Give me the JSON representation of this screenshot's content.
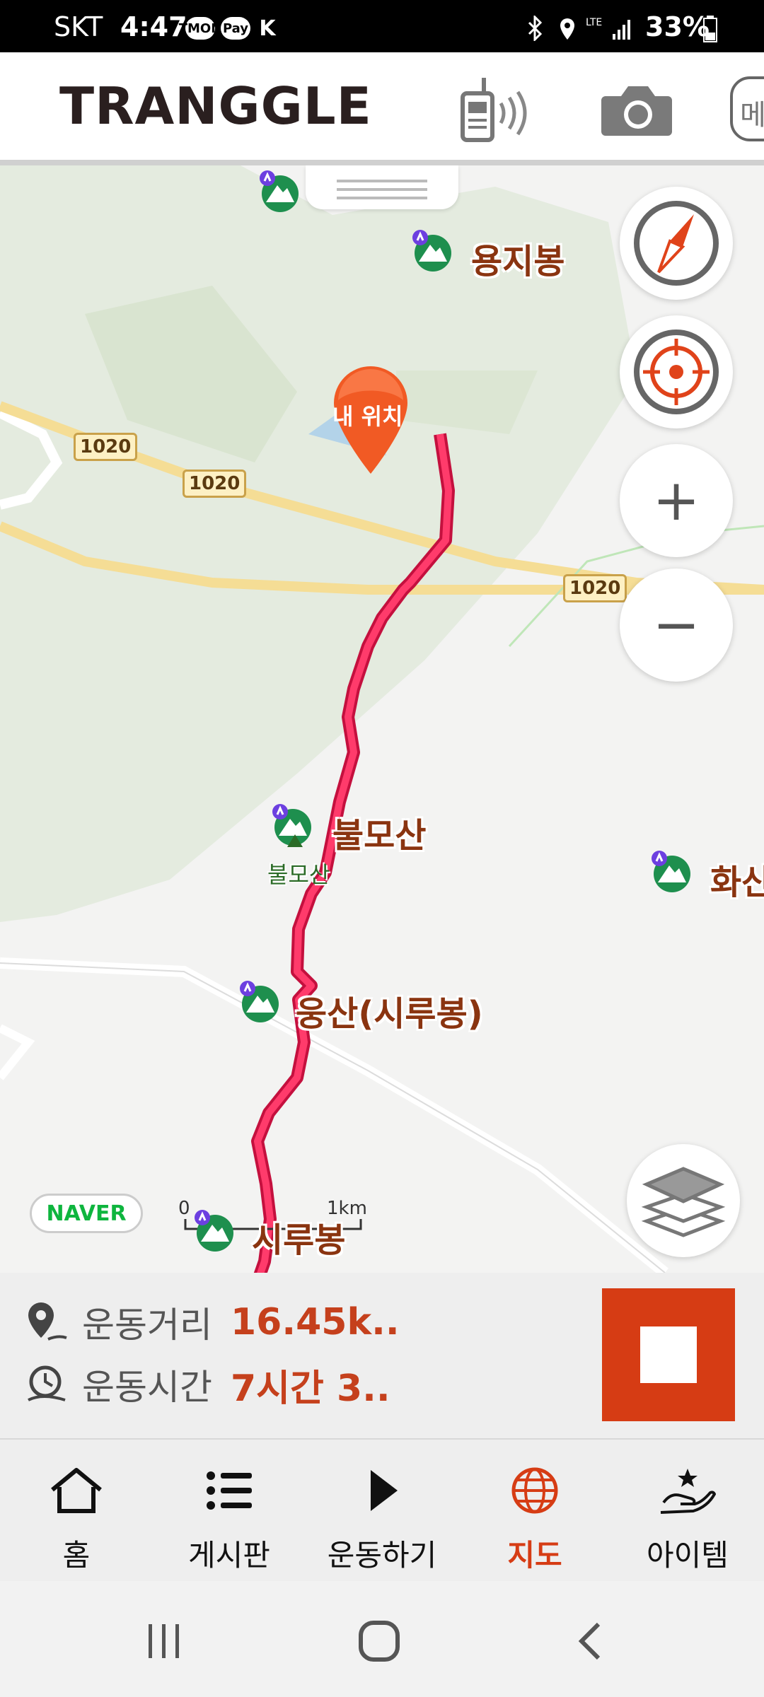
{
  "status_bar": {
    "carrier": "SKT",
    "time": "4:47",
    "app_icons": [
      "TMON",
      "Pay",
      "K"
    ],
    "right_icons": [
      "bluetooth-icon",
      "location-icon",
      "lte-icon",
      "signal-icon"
    ],
    "network": "LTE",
    "battery": "33%"
  },
  "header": {
    "logo": "TRANGGLE",
    "walkie_icon": "walkie-talkie-icon",
    "camera_icon": "camera-icon",
    "menu_label": "메"
  },
  "map": {
    "roads": [
      "1020",
      "1020",
      "1020"
    ],
    "my_location_label": "내 위치",
    "peaks": [
      {
        "name": "용지봉"
      },
      {
        "name": "불모산",
        "sub": "불모산"
      },
      {
        "name": "화산"
      },
      {
        "name": "웅산(시루봉)"
      },
      {
        "name": "시루봉"
      }
    ],
    "buttons": {
      "compass": "compass-icon",
      "locate": "crosshair-icon",
      "zoom_in": "+",
      "zoom_out": "−",
      "layers": "layers-icon"
    },
    "attribution": "NAVER",
    "scale": {
      "start": "0",
      "end": "1km"
    },
    "colors": {
      "route": "#ff3b6b",
      "route_outline": "#c4103e",
      "pin": "#f15a24"
    }
  },
  "info": {
    "distance_label": "운동거리",
    "distance_value": "16.45k..",
    "time_label": "운동시간",
    "time_value": "7시간 3..",
    "stop_button": "stop-icon",
    "accent": "#d63c14"
  },
  "tabs": [
    {
      "label": "홈",
      "icon": "home-icon",
      "active": false
    },
    {
      "label": "게시판",
      "icon": "list-icon",
      "active": false
    },
    {
      "label": "운동하기",
      "icon": "play-icon",
      "active": false
    },
    {
      "label": "지도",
      "icon": "globe-icon",
      "active": true
    },
    {
      "label": "아이템",
      "icon": "hand-star-icon",
      "active": false
    }
  ],
  "nav": {
    "recent": "recent-apps-icon",
    "home": "home-circle-icon",
    "back": "back-icon"
  }
}
